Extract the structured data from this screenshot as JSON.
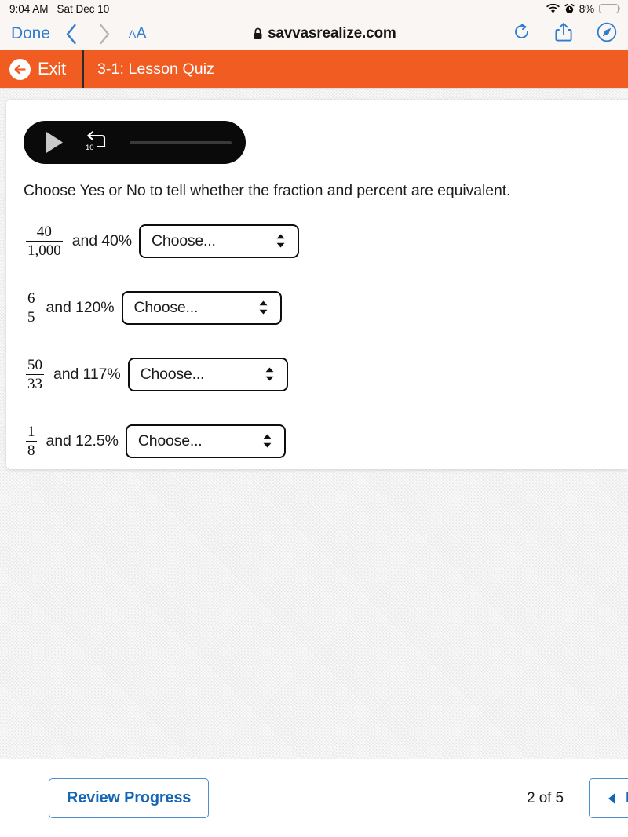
{
  "status_bar": {
    "time": "9:04 AM",
    "date": "Sat Dec 10",
    "wifi_icon": "wifi-icon",
    "alarm_icon": "alarm-clock-icon",
    "battery_percent": "8%",
    "battery_level": 8,
    "battery_color": "#f2c233"
  },
  "browser": {
    "done_label": "Done",
    "back_icon": "chevron-left-icon",
    "forward_icon": "chevron-right-icon",
    "text_size_small": "A",
    "text_size_large": "A",
    "lock_icon": "lock-icon",
    "url": "savvasrealize.com",
    "reload_icon": "reload-icon",
    "share_icon": "share-icon",
    "safari_icon": "safari-compass-icon",
    "accent_color": "#2f7dd1"
  },
  "app_header": {
    "exit_icon": "arrow-left-circle-icon",
    "exit_label": "Exit",
    "title": "3-1: Lesson Quiz",
    "background_color": "#f05c22"
  },
  "audio_player": {
    "play_icon": "play-icon",
    "rewind_icon": "rewind-10-icon",
    "rewind_seconds": "10",
    "progress_percent": 0
  },
  "question": {
    "prompt": "Choose Yes or No to tell whether the fraction and percent are equivalent.",
    "rows": [
      {
        "numerator": "40",
        "denominator": "1,000",
        "text": "and 40%",
        "select_value": "Choose...",
        "select_width": 212
      },
      {
        "numerator": "6",
        "denominator": "5",
        "text": "and 120%",
        "select_value": "Choose...",
        "select_width": 212
      },
      {
        "numerator": "50",
        "denominator": "33",
        "text": "and 117%",
        "select_value": "Choose...",
        "select_width": 212
      },
      {
        "numerator": "1",
        "denominator": "8",
        "text": "and 12.5%",
        "select_value": "Choose...",
        "select_width": 212
      }
    ]
  },
  "footer": {
    "review_label": "Review Progress",
    "page_indicator": "2 of 5",
    "back_icon": "triangle-left-icon",
    "back_label": "B",
    "accent_color": "#1565b8"
  }
}
